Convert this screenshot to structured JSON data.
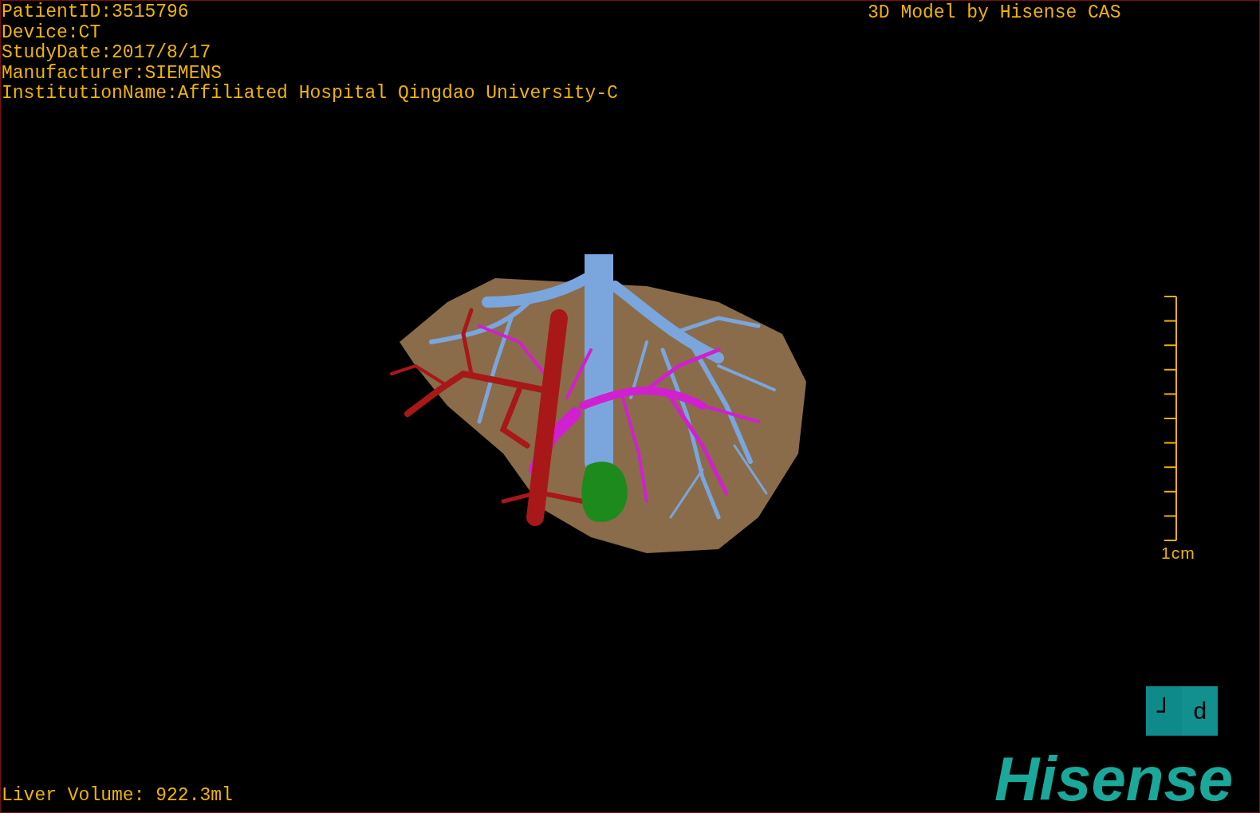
{
  "info_lines": [
    "PatientID:3515796",
    "Device:CT",
    "StudyDate:2017/8/17",
    "Manufacturer:SIEMENS",
    "InstitutionName:Affiliated Hospital Qingdao University-C"
  ],
  "credit": "3D Model by Hisense CAS",
  "scale_bar": {
    "label": "1cm"
  },
  "orientation_cube": {
    "left_face": "┘",
    "right_face": "d"
  },
  "liver_volume": "Liver Volume: 922.3ml",
  "logo": "Hisense"
}
